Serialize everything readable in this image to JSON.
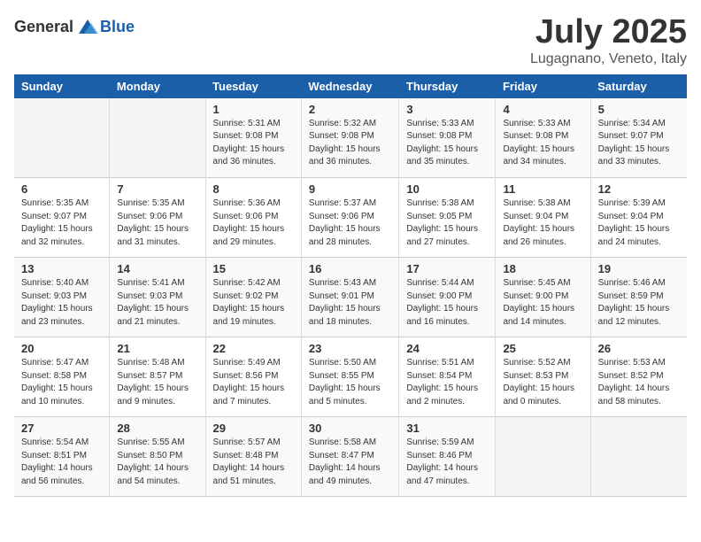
{
  "logo": {
    "general": "General",
    "blue": "Blue"
  },
  "title": "July 2025",
  "location": "Lugagnano, Veneto, Italy",
  "weekdays": [
    "Sunday",
    "Monday",
    "Tuesday",
    "Wednesday",
    "Thursday",
    "Friday",
    "Saturday"
  ],
  "weeks": [
    [
      {
        "day": "",
        "info": ""
      },
      {
        "day": "",
        "info": ""
      },
      {
        "day": "1",
        "info": "Sunrise: 5:31 AM\nSunset: 9:08 PM\nDaylight: 15 hours and 36 minutes."
      },
      {
        "day": "2",
        "info": "Sunrise: 5:32 AM\nSunset: 9:08 PM\nDaylight: 15 hours and 36 minutes."
      },
      {
        "day": "3",
        "info": "Sunrise: 5:33 AM\nSunset: 9:08 PM\nDaylight: 15 hours and 35 minutes."
      },
      {
        "day": "4",
        "info": "Sunrise: 5:33 AM\nSunset: 9:08 PM\nDaylight: 15 hours and 34 minutes."
      },
      {
        "day": "5",
        "info": "Sunrise: 5:34 AM\nSunset: 9:07 PM\nDaylight: 15 hours and 33 minutes."
      }
    ],
    [
      {
        "day": "6",
        "info": "Sunrise: 5:35 AM\nSunset: 9:07 PM\nDaylight: 15 hours and 32 minutes."
      },
      {
        "day": "7",
        "info": "Sunrise: 5:35 AM\nSunset: 9:06 PM\nDaylight: 15 hours and 31 minutes."
      },
      {
        "day": "8",
        "info": "Sunrise: 5:36 AM\nSunset: 9:06 PM\nDaylight: 15 hours and 29 minutes."
      },
      {
        "day": "9",
        "info": "Sunrise: 5:37 AM\nSunset: 9:06 PM\nDaylight: 15 hours and 28 minutes."
      },
      {
        "day": "10",
        "info": "Sunrise: 5:38 AM\nSunset: 9:05 PM\nDaylight: 15 hours and 27 minutes."
      },
      {
        "day": "11",
        "info": "Sunrise: 5:38 AM\nSunset: 9:04 PM\nDaylight: 15 hours and 26 minutes."
      },
      {
        "day": "12",
        "info": "Sunrise: 5:39 AM\nSunset: 9:04 PM\nDaylight: 15 hours and 24 minutes."
      }
    ],
    [
      {
        "day": "13",
        "info": "Sunrise: 5:40 AM\nSunset: 9:03 PM\nDaylight: 15 hours and 23 minutes."
      },
      {
        "day": "14",
        "info": "Sunrise: 5:41 AM\nSunset: 9:03 PM\nDaylight: 15 hours and 21 minutes."
      },
      {
        "day": "15",
        "info": "Sunrise: 5:42 AM\nSunset: 9:02 PM\nDaylight: 15 hours and 19 minutes."
      },
      {
        "day": "16",
        "info": "Sunrise: 5:43 AM\nSunset: 9:01 PM\nDaylight: 15 hours and 18 minutes."
      },
      {
        "day": "17",
        "info": "Sunrise: 5:44 AM\nSunset: 9:00 PM\nDaylight: 15 hours and 16 minutes."
      },
      {
        "day": "18",
        "info": "Sunrise: 5:45 AM\nSunset: 9:00 PM\nDaylight: 15 hours and 14 minutes."
      },
      {
        "day": "19",
        "info": "Sunrise: 5:46 AM\nSunset: 8:59 PM\nDaylight: 15 hours and 12 minutes."
      }
    ],
    [
      {
        "day": "20",
        "info": "Sunrise: 5:47 AM\nSunset: 8:58 PM\nDaylight: 15 hours and 10 minutes."
      },
      {
        "day": "21",
        "info": "Sunrise: 5:48 AM\nSunset: 8:57 PM\nDaylight: 15 hours and 9 minutes."
      },
      {
        "day": "22",
        "info": "Sunrise: 5:49 AM\nSunset: 8:56 PM\nDaylight: 15 hours and 7 minutes."
      },
      {
        "day": "23",
        "info": "Sunrise: 5:50 AM\nSunset: 8:55 PM\nDaylight: 15 hours and 5 minutes."
      },
      {
        "day": "24",
        "info": "Sunrise: 5:51 AM\nSunset: 8:54 PM\nDaylight: 15 hours and 2 minutes."
      },
      {
        "day": "25",
        "info": "Sunrise: 5:52 AM\nSunset: 8:53 PM\nDaylight: 15 hours and 0 minutes."
      },
      {
        "day": "26",
        "info": "Sunrise: 5:53 AM\nSunset: 8:52 PM\nDaylight: 14 hours and 58 minutes."
      }
    ],
    [
      {
        "day": "27",
        "info": "Sunrise: 5:54 AM\nSunset: 8:51 PM\nDaylight: 14 hours and 56 minutes."
      },
      {
        "day": "28",
        "info": "Sunrise: 5:55 AM\nSunset: 8:50 PM\nDaylight: 14 hours and 54 minutes."
      },
      {
        "day": "29",
        "info": "Sunrise: 5:57 AM\nSunset: 8:48 PM\nDaylight: 14 hours and 51 minutes."
      },
      {
        "day": "30",
        "info": "Sunrise: 5:58 AM\nSunset: 8:47 PM\nDaylight: 14 hours and 49 minutes."
      },
      {
        "day": "31",
        "info": "Sunrise: 5:59 AM\nSunset: 8:46 PM\nDaylight: 14 hours and 47 minutes."
      },
      {
        "day": "",
        "info": ""
      },
      {
        "day": "",
        "info": ""
      }
    ]
  ]
}
